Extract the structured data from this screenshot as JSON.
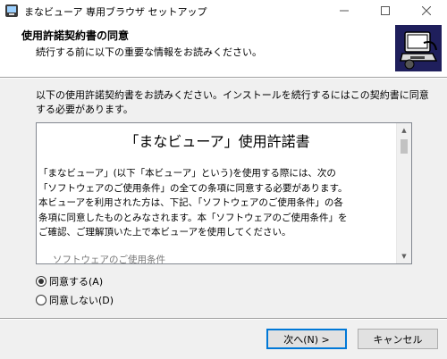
{
  "window": {
    "title": "まなビューア 専用ブラウザ セットアップ",
    "icon": "setup-app-icon",
    "controls": {
      "minimize": "minimize-icon",
      "maximize": "maximize-icon",
      "close": "close-icon"
    }
  },
  "header": {
    "title": "使用許諾契約書の同意",
    "subtitle": "続行する前に以下の重要な情報をお読みください。",
    "image": "computer-install-icon"
  },
  "main": {
    "prompt": "以下の使用許諾契約書をお読みください。インストールを続行するにはこの契約書に同意する必要があります。"
  },
  "license": {
    "heading": "「まなビューア」使用許諾書",
    "lines": [
      "「まなビューア」(以下「本ビューア」という)を使用する際には、次の",
      "「ソフトウェアのご使用条件」の全ての条項に同意する必要があります。",
      "本ビューアを利用された方は、下記、「ソフトウェアのご使用条件」の各",
      "条項に同意したものとみなされます。本「ソフトウェアのご使用条件」を",
      "ご確認、ご理解頂いた上で本ビューアを使用してください。"
    ],
    "next_line": "ソフトウェアのご使用条件"
  },
  "options": {
    "accept_label": "同意する(A)",
    "decline_label": "同意しない(D)",
    "selected": "accept"
  },
  "buttons": {
    "next": "次へ(N) >",
    "cancel": "キャンセル"
  }
}
